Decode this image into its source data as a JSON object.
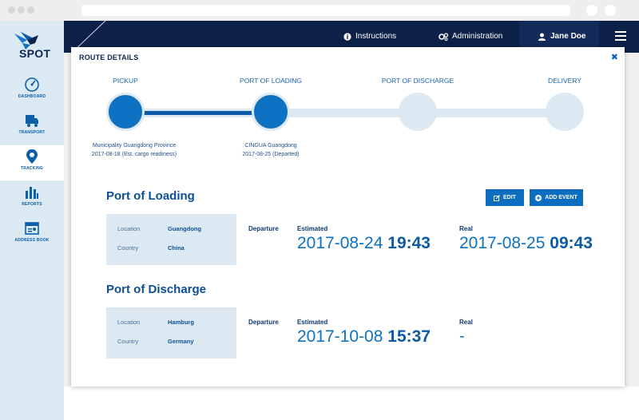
{
  "topbar": {
    "instructions_label": "Instructions",
    "administration_label": "Administration",
    "user_name": "Jane Doe"
  },
  "logo": {
    "text": "SPOT"
  },
  "sidebar": {
    "items": [
      {
        "label": "DASHBOARD",
        "icon": "gauge-icon"
      },
      {
        "label": "TRANSPORT",
        "icon": "truck-icon"
      },
      {
        "label": "TRACKING",
        "icon": "map-pin-icon",
        "active": true
      },
      {
        "label": "REPORTS",
        "icon": "bar-chart-icon"
      },
      {
        "label": "ADDRESS BOOK",
        "icon": "address-card-icon"
      }
    ]
  },
  "modal": {
    "title": "ROUTE DETAILS",
    "steps": [
      {
        "label": "PICKUP",
        "status": "done",
        "line1": "Municipality Guangdong Province",
        "line2": "2017-08-18 (Est. cargo readiness)"
      },
      {
        "label": "PORT OF LOADING",
        "status": "done",
        "line1": "CINGUA Guangdong",
        "line2": "2017-08-25 (Departed)"
      },
      {
        "label": "PORT OF DISCHARGE",
        "status": "todo",
        "line1": "",
        "line2": ""
      },
      {
        "label": "DELIVERY",
        "status": "todo",
        "line1": "",
        "line2": ""
      }
    ],
    "edit_label": "EDIT",
    "add_event_label": "ADD EVENT",
    "loading": {
      "title": "Port of Loading",
      "location_key": "Location",
      "location_val": "Guangdong",
      "country_key": "Country",
      "country_val": "China",
      "event": "Departure",
      "estimated_label": "Estimated",
      "estimated_date": "2017-08-24",
      "estimated_time": "19:43",
      "real_label": "Real",
      "real_date": "2017-08-25",
      "real_time": "09:43"
    },
    "discharge": {
      "title": "Port of Discharge",
      "location_key": "Location",
      "location_val": "Hamburg",
      "country_key": "Country",
      "country_val": "Germany",
      "event": "Departure",
      "estimated_label": "Estimated",
      "estimated_date": "2017-10-08",
      "estimated_time": "15:37",
      "real_label": "Real",
      "real_value": "-"
    }
  },
  "colors": {
    "navy": "#0d2048",
    "accent": "#0d72c2",
    "light": "#dce9f3"
  }
}
